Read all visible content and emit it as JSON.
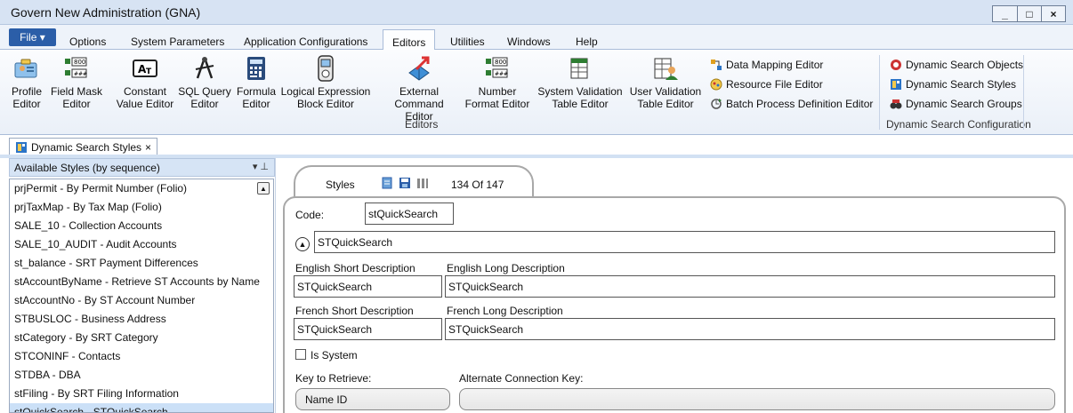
{
  "window": {
    "title": "Govern New Administration (GNA)",
    "controls": [
      "_",
      "□",
      "×"
    ]
  },
  "menu": {
    "file": "File ▾",
    "items": [
      "Options",
      "System Parameters",
      "Application Configurations",
      "Editors",
      "Utilities",
      "Windows",
      "Help"
    ],
    "active": "Editors"
  },
  "ribbon": {
    "buttons": [
      {
        "line1": "Profile",
        "line2": "Editor",
        "icon": "profile-icon"
      },
      {
        "line1": "Field Mask",
        "line2": "Editor",
        "icon": "field-mask-icon"
      },
      {
        "line1": "Constant",
        "line2": "Value Editor",
        "icon": "constant-icon"
      },
      {
        "line1": "SQL Query",
        "line2": "Editor",
        "icon": "compass-icon"
      },
      {
        "line1": "Formula",
        "line2": "Editor",
        "icon": "calculator-icon"
      },
      {
        "line1": "Logical Expression",
        "line2": "Block Editor",
        "icon": "device-icon"
      },
      {
        "line1": "External",
        "line2": "Command Editor",
        "icon": "arrow-cube-icon"
      },
      {
        "line1": "Number",
        "line2": "Format Editor",
        "icon": "number-format-icon"
      },
      {
        "line1": "System Validation",
        "line2": "Table Editor",
        "icon": "table-icon"
      },
      {
        "line1": "User Validation",
        "line2": "Table Editor",
        "icon": "user-table-icon"
      }
    ],
    "small_items": [
      {
        "label": "Data Mapping Editor",
        "icon": "data-mapping-icon"
      },
      {
        "label": "Resource File Editor",
        "icon": "resource-file-icon"
      },
      {
        "label": "Batch Process Definition Editor",
        "icon": "batch-process-icon"
      }
    ],
    "group_editors": "Editors",
    "dyn_items": [
      {
        "label": "Dynamic Search Objects",
        "icon": "search-objects-icon"
      },
      {
        "label": "Dynamic Search Styles",
        "icon": "search-styles-icon"
      },
      {
        "label": "Dynamic Search Groups",
        "icon": "search-groups-icon"
      }
    ],
    "group_dynamic": "Dynamic Search Configuration"
  },
  "doc_tab": {
    "label": "Dynamic Search Styles",
    "close": "×"
  },
  "left_panel": {
    "header": "Available Styles (by sequence)",
    "pins": "▾ ⊥",
    "items": [
      "prjPermit - By Permit Number (Folio)",
      "prjTaxMap - By Tax Map (Folio)",
      "SALE_10 - Collection Accounts",
      "SALE_10_AUDIT - Audit Accounts",
      "st_balance - SRT Payment Differences",
      "stAccountByName - Retrieve ST Accounts by Name",
      "stAccountNo - By ST Account Number",
      "STBUSLOC - Business Address",
      "stCategory - By SRT Category",
      "STCONINF - Contacts",
      "STDBA - DBA",
      "stFiling - By SRT Filing Information",
      "stQuickSearch - STQuickSearch"
    ],
    "selected_index": 12
  },
  "detail": {
    "tab_label": "Styles",
    "record_count": "134 Of 147",
    "code_label": "Code:",
    "code_value": "stQuickSearch",
    "collapsed_title": "STQuickSearch",
    "en_short_label": "English Short Description",
    "en_long_label": "English Long Description",
    "en_short_value": "STQuickSearch",
    "en_long_value": "STQuickSearch",
    "fr_short_label": "French Short Description",
    "fr_long_label": "French Long Description",
    "fr_short_value": "STQuickSearch",
    "fr_long_value": "STQuickSearch",
    "is_system_label": "Is System",
    "is_system_checked": false,
    "key_label": "Key to Retrieve:",
    "alt_key_label": "Alternate Connection Key:",
    "key_value": "Name ID",
    "alt_key_value": ""
  },
  "colors": {
    "title_bg": "#d7e3f3",
    "file_button": "#2b5ea8",
    "selection": "#cbe0f7",
    "panel_header": "#d6e4f5"
  }
}
